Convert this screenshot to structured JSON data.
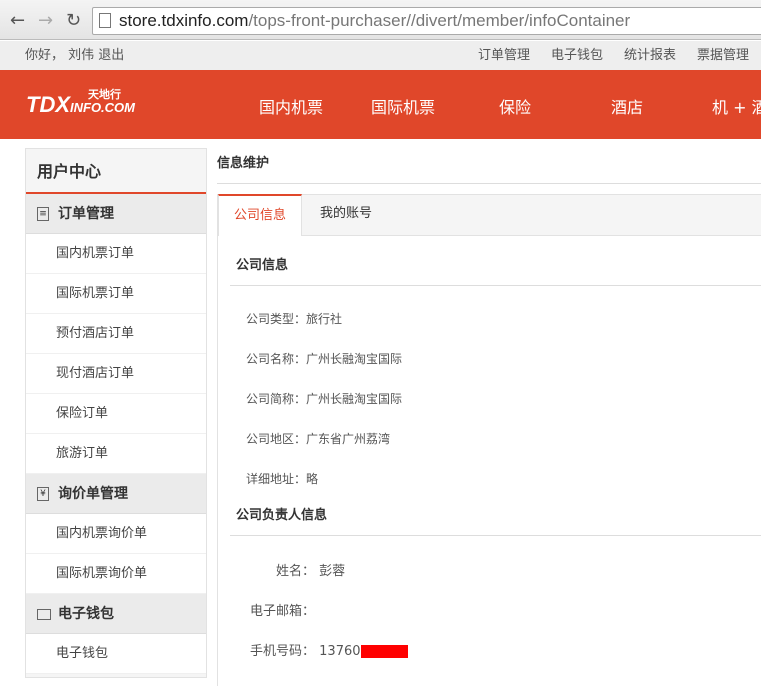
{
  "browser": {
    "url_host": "store.tdxinfo.com",
    "url_path": "/tops-front-purchaser//divert/member/infoContainer"
  },
  "topbar": {
    "greeting": "你好， 刘伟 退出",
    "links": [
      "订单管理",
      "电子钱包",
      "统计报表",
      "票据管理"
    ]
  },
  "header": {
    "logo": "TDX",
    "logo_small": "INFO.COM",
    "logo_cn": "天地行",
    "nav": [
      "国内机票",
      "国际机票",
      "保险",
      "酒店",
      "机 + 酒"
    ]
  },
  "sidebar": {
    "title": "用户中心",
    "groups": [
      {
        "label": "订单管理",
        "icon": "list-icon",
        "items": [
          "国内机票订单",
          "国际机票订单",
          "预付酒店订单",
          "现付酒店订单",
          "保险订单",
          "旅游订单"
        ]
      },
      {
        "label": "询价单管理",
        "icon": "yen-icon",
        "items": [
          "国内机票询价单",
          "国际机票询价单"
        ]
      },
      {
        "label": "电子钱包",
        "icon": "wallet-icon",
        "items": [
          "电子钱包"
        ]
      }
    ]
  },
  "content": {
    "breadcrumb": "信息维护",
    "tabs": [
      "公司信息",
      "我的账号"
    ],
    "company_section": "公司信息",
    "company": [
      {
        "label": "公司类型：",
        "value": "旅行社"
      },
      {
        "label": "公司名称：",
        "value": "广州长融淘宝国际"
      },
      {
        "label": "公司简称：",
        "value": "广州长融淘宝国际"
      },
      {
        "label": "公司地区：",
        "value": "广东省广州荔湾"
      },
      {
        "label": "详细地址：",
        "value": "略"
      }
    ],
    "contact_section": "公司负责人信息",
    "contact": [
      {
        "label": "姓名：",
        "value": "彭蓉"
      },
      {
        "label": "电子邮箱：",
        "value": ""
      },
      {
        "label": "手机号码：",
        "value": "13760"
      }
    ],
    "redaction_color": "#ff0000"
  }
}
